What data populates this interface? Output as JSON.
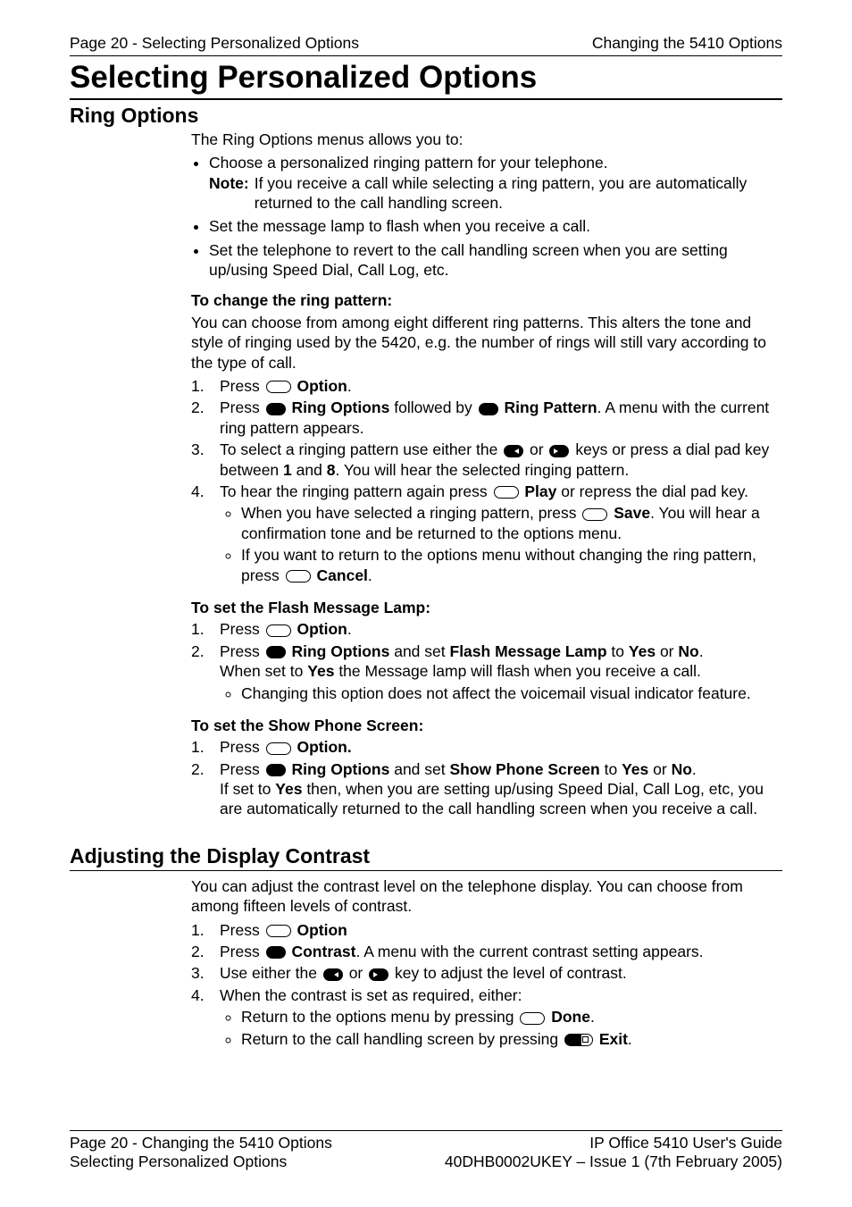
{
  "header": {
    "left": "Page 20 - Selecting Personalized Options",
    "right": "Changing the 5410 Options"
  },
  "chapterTitle": "Selecting Personalized Options",
  "sections": {
    "ring": {
      "heading": "Ring Options",
      "intro": "The Ring Options menus allows you to:",
      "bullets": {
        "b1": "Choose a personalized ringing pattern for your telephone.",
        "b1note_label": "Note:",
        "b1note_text": "If you receive a call while selecting a ring pattern, you are automatically returned to the call handling screen.",
        "b2": "Set the message lamp to flash when you receive a call.",
        "b3": "Set the telephone to revert to the call handling screen when you are setting up/using Speed Dial, Call Log, etc."
      },
      "change": {
        "subhead": "To change the ring pattern:",
        "para": "You can choose from among eight different ring patterns. This alters the tone and style of ringing used by the 5420, e.g. the number of rings will still vary according to the type of call.",
        "s1_a": "Press ",
        "s1_b": " Option",
        "s1_c": ".",
        "s2_a": "Press ",
        "s2_b": " Ring Options",
        "s2_c": " followed by ",
        "s2_d": " Ring Pattern",
        "s2_e": ". A menu with the current ring pattern appears.",
        "s3_a": "To select a ringing pattern use either the ",
        "s3_b": " or ",
        "s3_c": " keys or press a dial pad key between ",
        "s3_d": "1",
        "s3_e": " and ",
        "s3_f": "8",
        "s3_g": ". You will hear the selected ringing pattern.",
        "s4_a": "To hear the ringing pattern again press ",
        "s4_b": " Play",
        "s4_c": " or repress the dial pad key.",
        "s4_sub1_a": "When you have selected a ringing pattern, press ",
        "s4_sub1_b": " Save",
        "s4_sub1_c": ". You will hear a confirmation tone and be returned to the options menu.",
        "s4_sub2_a": "If you want to return to the options menu without changing the ring pattern, press ",
        "s4_sub2_b": " Cancel",
        "s4_sub2_c": "."
      },
      "flash": {
        "subhead": "To set the Flash Message Lamp:",
        "s1_a": "Press ",
        "s1_b": " Option",
        "s1_c": ".",
        "s2_a": "Press ",
        "s2_b": " Ring Options",
        "s2_c": " and set ",
        "s2_d": "Flash Message Lamp",
        "s2_e": " to ",
        "s2_f": "Yes",
        "s2_g": " or ",
        "s2_h": "No",
        "s2_i": ".",
        "s2_line2_a": "When set to ",
        "s2_line2_b": "Yes",
        "s2_line2_c": " the Message lamp will flash when you receive a call.",
        "s2_sub1": "Changing this option does not affect the voicemail visual indicator feature."
      },
      "show": {
        "subhead": "To set the Show Phone Screen:",
        "s1_a": "Press ",
        "s1_b": " Option.",
        "s2_a": "Press ",
        "s2_b": " Ring Options",
        "s2_c": " and set ",
        "s2_d": "Show Phone Screen",
        "s2_e": " to ",
        "s2_f": "Yes",
        "s2_g": " or ",
        "s2_h": "No",
        "s2_i": ".",
        "s2_line2_a": "If set to ",
        "s2_line2_b": "Yes",
        "s2_line2_c": " then, when you are setting up/using Speed Dial, Call Log, etc, you are automatically returned to the call handling screen when you receive a call."
      }
    },
    "contrast": {
      "heading": "Adjusting the Display Contrast",
      "para": "You can adjust the contrast level on the telephone display. You can choose from among fifteen levels of contrast.",
      "s1_a": "Press ",
      "s1_b": " Option",
      "s2_a": "Press ",
      "s2_b": " Contrast",
      "s2_c": ". A menu with the current contrast setting appears.",
      "s3_a": "Use either the ",
      "s3_b": " or ",
      "s3_c": " key to adjust the level of contrast.",
      "s4_a": "When the contrast is set as required, either:",
      "s4_sub1_a": "Return to the options menu by pressing ",
      "s4_sub1_b": " Done",
      "s4_sub1_c": ".",
      "s4_sub2_a": "Return to the call handling screen by pressing ",
      "s4_sub2_b": " Exit",
      "s4_sub2_c": "."
    }
  },
  "footer": {
    "l1": "Page 20 - Changing the 5410 Options",
    "r1": "IP Office 5410 User's Guide",
    "l2": "Selecting Personalized Options",
    "r2": "40DHB0002UKEY – Issue 1 (7th February 2005)"
  }
}
